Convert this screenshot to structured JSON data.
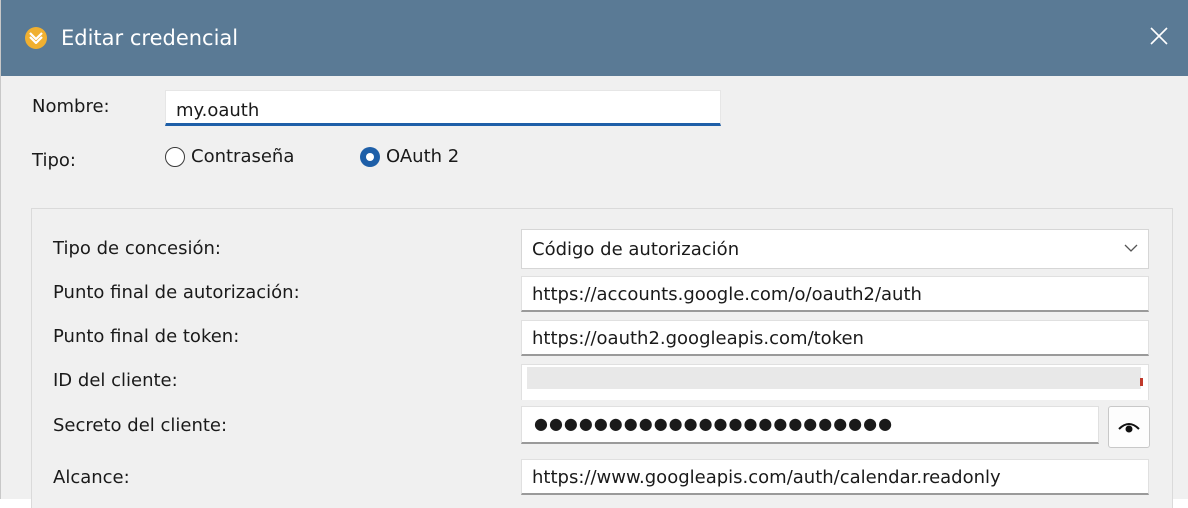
{
  "window": {
    "title": "Editar credencial",
    "close_icon": "close-icon",
    "app_icon": "app-logo-icon"
  },
  "form": {
    "name_label": "Nombre:",
    "name_value": "my.oauth",
    "type_label": "Tipo:",
    "type_options": [
      "Contraseña",
      "OAuth 2"
    ],
    "type_selected": "OAuth 2"
  },
  "oauth": {
    "grant_type": {
      "label": "Tipo de concesión:",
      "value": "Código de autorización"
    },
    "auth_endpoint": {
      "label": "Punto final de autorización:",
      "value": "https://accounts.google.com/o/oauth2/auth"
    },
    "token_endpoint": {
      "label": "Punto final de token:",
      "value": "https://oauth2.googleapis.com/token"
    },
    "client_id": {
      "label": "ID del cliente:",
      "value": ""
    },
    "client_secret": {
      "label": "Secreto del cliente:",
      "value": "●●●●●●●●●●●●●●●●●●●●●●●●"
    },
    "scope": {
      "label": "Alcance:",
      "value": "https://www.googleapis.com/auth/calendar.readonly"
    }
  },
  "colors": {
    "titlebar": "#5a7a95",
    "accent": "#1e5fa8",
    "background": "#f0f0f0"
  }
}
